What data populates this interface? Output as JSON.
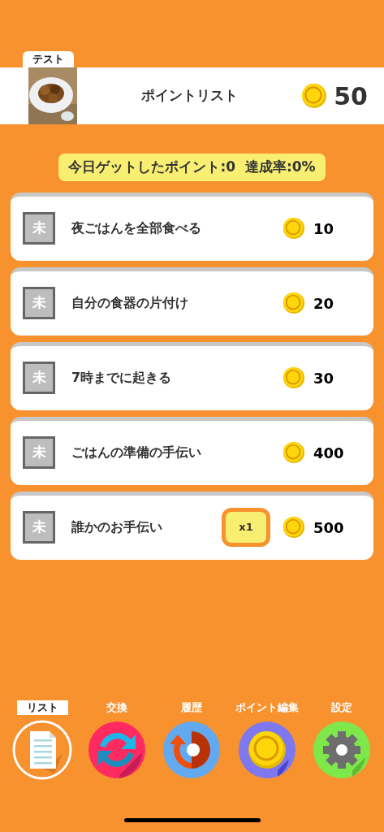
{
  "header": {
    "profile_tab": "テスト",
    "title": "ポイントリスト",
    "points": "50"
  },
  "summary": "今日ゲットしたポイント:0  達成率:0%",
  "tasks": [
    {
      "status": "未",
      "name": "夜ごはんを全部食べる",
      "points": "10"
    },
    {
      "status": "未",
      "name": "自分の食器の片付け",
      "points": "20"
    },
    {
      "status": "未",
      "name": "7時までに起きる",
      "points": "30"
    },
    {
      "status": "未",
      "name": "ごはんの準備の手伝い",
      "points": "400"
    },
    {
      "status": "未",
      "name": "誰かのお手伝い",
      "multiplier": "x1",
      "points": "500"
    }
  ],
  "nav": [
    {
      "kind": "list",
      "label": "リスト",
      "selected": true
    },
    {
      "kind": "exchange",
      "label": "交換",
      "selected": false
    },
    {
      "kind": "history",
      "label": "履歴",
      "selected": false
    },
    {
      "kind": "points",
      "label": "ポイント編集",
      "selected": false
    },
    {
      "kind": "settings",
      "label": "設定",
      "selected": false
    }
  ]
}
